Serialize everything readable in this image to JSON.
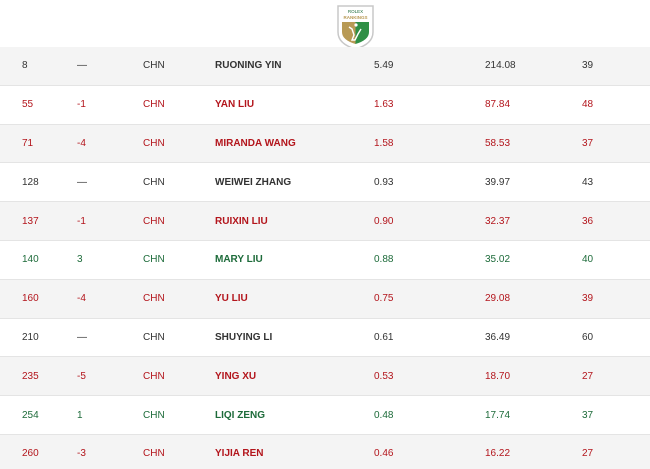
{
  "logo": {
    "brand_text": "ROLEX",
    "title_text": "RANKINGS",
    "colors": {
      "gold": "#b89a55",
      "green": "#2f8f45",
      "silver": "#c8c8c8"
    }
  },
  "status_colors": {
    "neutral": "#333333",
    "down": "#b3151c",
    "up": "#1d6b3a"
  },
  "rows": [
    {
      "rank": "8",
      "move": "—",
      "country": "CHN",
      "name": "RUONING YIN",
      "avg_points": "5.49",
      "total_points": "214.08",
      "events": "39",
      "status": "neutral"
    },
    {
      "rank": "55",
      "move": "-1",
      "country": "CHN",
      "name": "YAN LIU",
      "avg_points": "1.63",
      "total_points": "87.84",
      "events": "48",
      "status": "down"
    },
    {
      "rank": "71",
      "move": "-4",
      "country": "CHN",
      "name": "MIRANDA WANG",
      "avg_points": "1.58",
      "total_points": "58.53",
      "events": "37",
      "status": "down"
    },
    {
      "rank": "128",
      "move": "—",
      "country": "CHN",
      "name": "WEIWEI ZHANG",
      "avg_points": "0.93",
      "total_points": "39.97",
      "events": "43",
      "status": "neutral"
    },
    {
      "rank": "137",
      "move": "-1",
      "country": "CHN",
      "name": "RUIXIN LIU",
      "avg_points": "0.90",
      "total_points": "32.37",
      "events": "36",
      "status": "down"
    },
    {
      "rank": "140",
      "move": "3",
      "country": "CHN",
      "name": "MARY LIU",
      "avg_points": "0.88",
      "total_points": "35.02",
      "events": "40",
      "status": "up"
    },
    {
      "rank": "160",
      "move": "-4",
      "country": "CHN",
      "name": "YU LIU",
      "avg_points": "0.75",
      "total_points": "29.08",
      "events": "39",
      "status": "down"
    },
    {
      "rank": "210",
      "move": "—",
      "country": "CHN",
      "name": "SHUYING LI",
      "avg_points": "0.61",
      "total_points": "36.49",
      "events": "60",
      "status": "neutral"
    },
    {
      "rank": "235",
      "move": "-5",
      "country": "CHN",
      "name": "YING XU",
      "avg_points": "0.53",
      "total_points": "18.70",
      "events": "27",
      "status": "down"
    },
    {
      "rank": "254",
      "move": "1",
      "country": "CHN",
      "name": "LIQI ZENG",
      "avg_points": "0.48",
      "total_points": "17.74",
      "events": "37",
      "status": "up"
    },
    {
      "rank": "260",
      "move": "-3",
      "country": "CHN",
      "name": "YIJIA REN",
      "avg_points": "0.46",
      "total_points": "16.22",
      "events": "27",
      "status": "down"
    }
  ]
}
